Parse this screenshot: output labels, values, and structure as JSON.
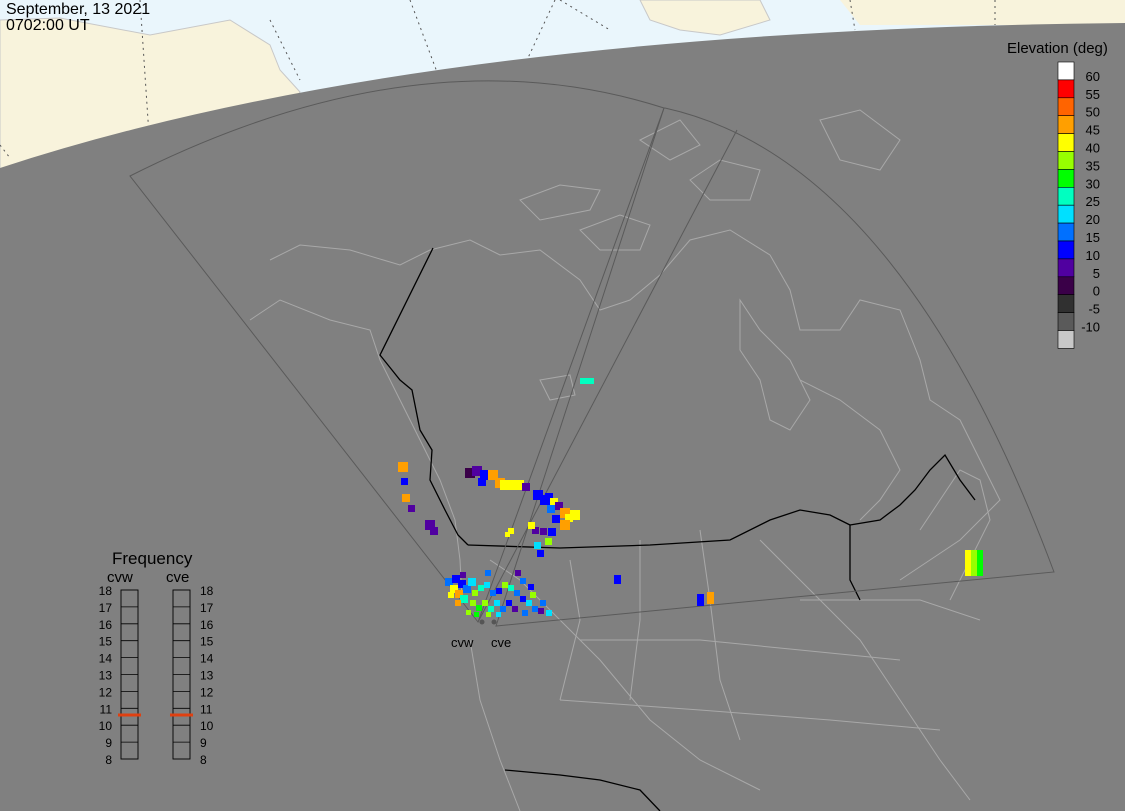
{
  "header": {
    "date": "September, 13 2021",
    "time": "0702:00 UT"
  },
  "legend": {
    "title": "Elevation (deg)",
    "entries": [
      {
        "label": "60",
        "color": "#ff0000"
      },
      {
        "label": "55",
        "color": "#ff6400"
      },
      {
        "label": "50",
        "color": "#ff9f00"
      },
      {
        "label": "45",
        "color": "#ffff00"
      },
      {
        "label": "40",
        "color": "#97ff00"
      },
      {
        "label": "35",
        "color": "#00ff00"
      },
      {
        "label": "30",
        "color": "#00ffc0"
      },
      {
        "label": "25",
        "color": "#00e0ff"
      },
      {
        "label": "20",
        "color": "#0070ff"
      },
      {
        "label": "15",
        "color": "#0000ff"
      },
      {
        "label": "10",
        "color": "#5000a0"
      },
      {
        "label": "5",
        "color": "#3a0048"
      },
      {
        "label": "0",
        "color": "#303030"
      },
      {
        "label": "-5",
        "color": "#5a5a5a"
      },
      {
        "label": "-10",
        "color": "#c8c8c8"
      }
    ],
    "top_color": "#ffffff"
  },
  "frequency": {
    "title": "Frequency",
    "radars": [
      "cvw",
      "cve"
    ],
    "ticks": [
      "18",
      "17",
      "16",
      "15",
      "14",
      "13",
      "12",
      "11",
      "10",
      "9",
      "8"
    ],
    "values_mhz": [
      10.6,
      10.6
    ],
    "marker_color": "#e04010"
  },
  "sites": {
    "west": "cvw",
    "east": "cve"
  },
  "colors": {
    "night_side": "#808080",
    "day_land": "#f8f3dc",
    "day_water": "#eaf6fc",
    "coastline": "#a8a8a8",
    "border": "#000000",
    "fov": "#5a5a5a"
  }
}
